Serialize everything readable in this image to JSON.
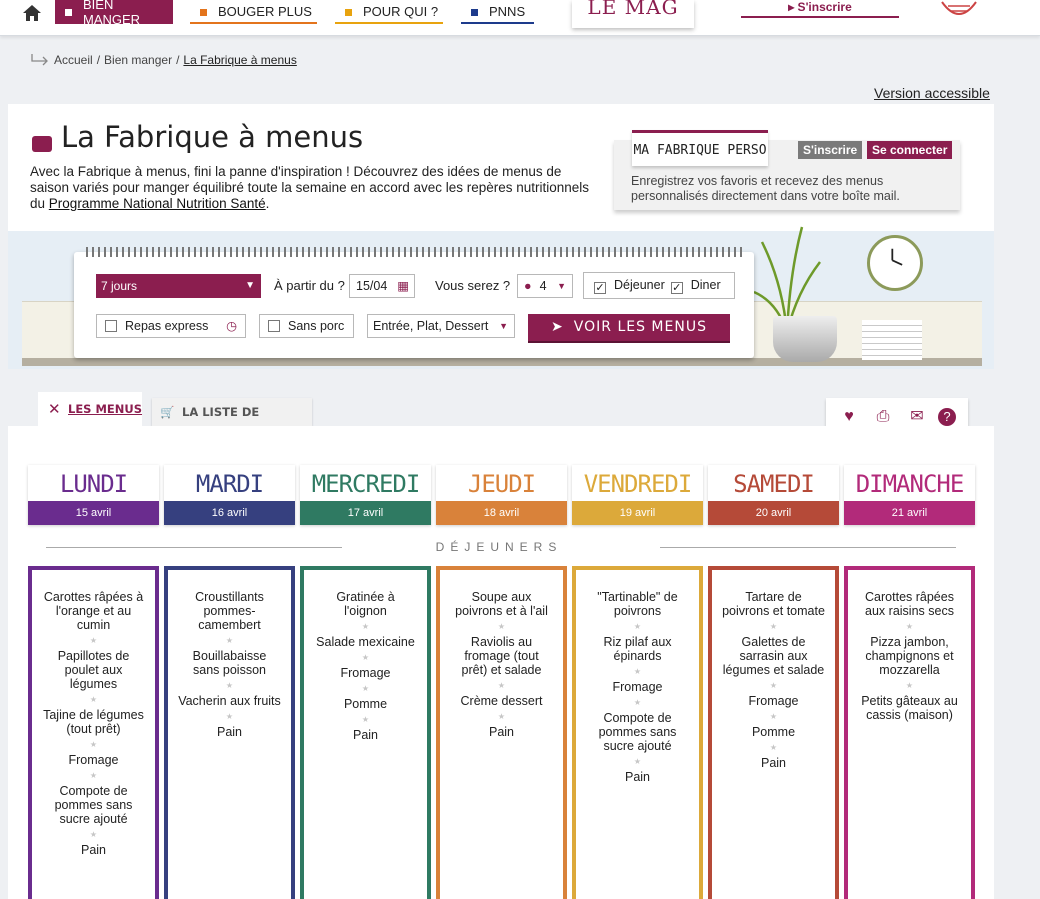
{
  "nav": {
    "items": [
      {
        "label": "BIEN MANGER",
        "color": "#8b1e4f",
        "active": true
      },
      {
        "label": "BOUGER PLUS",
        "color": "#e3741c"
      },
      {
        "label": "POUR QUI ?",
        "color": "#e8a30e"
      },
      {
        "label": "PNNS",
        "color": "#1d3b8c"
      }
    ],
    "mag": "LE MAG",
    "sinscrire": "▸ S'inscrire"
  },
  "breadcrumb": {
    "home": "Accueil",
    "sep": "/",
    "section": "Bien manger",
    "current": "La Fabrique à menus"
  },
  "accessible": "Version accessible",
  "page": {
    "title": "La Fabrique à menus",
    "intro": "Avec la Fabrique à menus, fini la panne d'inspiration ! Découvrez des idées de menus de saison variés pour manger équilibré toute la semaine en accord avec les repères nutritionnels du",
    "intro_link": "Programme National Nutrition Santé",
    "intro_end": "."
  },
  "perso": {
    "logo": "MA FABRIQUE PERSO",
    "signup": "S'inscrire",
    "login": "Se connecter",
    "text": "Enregistrez vos favoris et recevez des menus personnalisés directement dans votre boîte mail."
  },
  "form": {
    "days": "7 jours",
    "from_label": "À partir du ?",
    "date": "15/04",
    "people_label": "Vous serez ?",
    "people": "4",
    "lunch": "Déjeuner",
    "dinner": "Diner",
    "express": "Repas express",
    "no_pork": "Sans porc",
    "courses": "Entrée, Plat, Dessert",
    "submit": "VOIR LES MENUS"
  },
  "tabs": {
    "menus": "LES MENUS",
    "shopping": "LA LISTE DE COURSES"
  },
  "section_title": "DÉJEUNERS",
  "colors": {
    "brand": "#8b1e4f"
  },
  "days": [
    {
      "name": "LUNDI",
      "date": "15 avril",
      "color": "#6a2c8e",
      "dishes": [
        "Carottes râpées à l'orange et au cumin",
        "Papillotes de poulet aux légumes",
        "Tajine de légumes (tout prêt)",
        "Fromage",
        "Compote de pommes sans sucre ajouté",
        "Pain"
      ]
    },
    {
      "name": "MARDI",
      "date": "16 avril",
      "color": "#36407f",
      "dishes": [
        "Croustillants pommes-camembert",
        "Bouillabaisse sans poisson",
        "Vacherin aux fruits",
        "Pain"
      ]
    },
    {
      "name": "MERCREDI",
      "date": "17 avril",
      "color": "#2f7a62",
      "dishes": [
        "Gratinée à l'oignon",
        "Salade mexicaine",
        "Fromage",
        "Pomme",
        "Pain"
      ]
    },
    {
      "name": "JEUDI",
      "date": "18 avril",
      "color": "#d9823a",
      "dishes": [
        "Soupe aux poivrons et à l'ail",
        "Raviolis au fromage (tout prêt) et salade",
        "Crème dessert",
        "Pain"
      ]
    },
    {
      "name": "VENDREDI",
      "date": "19 avril",
      "color": "#dca93a",
      "dishes": [
        "\"Tartinable\" de poivrons",
        "Riz pilaf aux épinards",
        "Fromage",
        "Compote de pommes sans sucre ajouté",
        "Pain"
      ]
    },
    {
      "name": "SAMEDI",
      "date": "20 avril",
      "color": "#b54a38",
      "dishes": [
        "Tartare de poivrons et tomate",
        "Galettes de sarrasin aux légumes et salade",
        "Fromage",
        "Pomme",
        "Pain"
      ]
    },
    {
      "name": "DIMANCHE",
      "date": "21 avril",
      "color": "#b22a7a",
      "dishes": [
        "Carottes râpées aux raisins secs",
        "Pizza jambon, champignons et mozzarella",
        "Petits gâteaux au cassis (maison)"
      ]
    }
  ]
}
